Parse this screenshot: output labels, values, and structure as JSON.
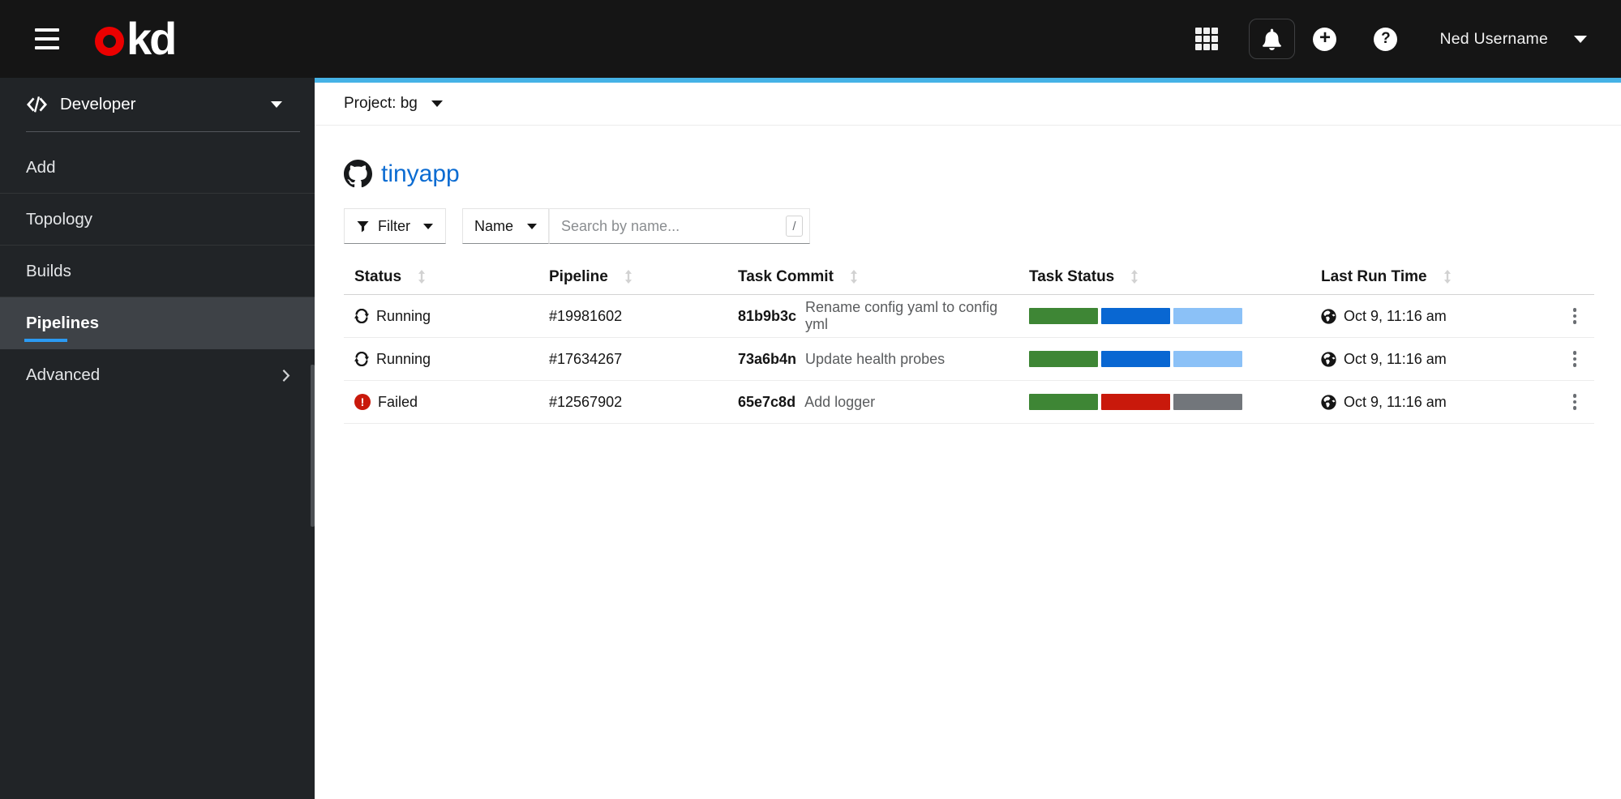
{
  "masthead": {
    "brand": {
      "text": "okd",
      "kd": "kd"
    },
    "user": {
      "name": "Ned Username"
    }
  },
  "sidebar": {
    "perspective": {
      "label": "Developer"
    },
    "items": [
      {
        "label": "Add"
      },
      {
        "label": "Topology"
      },
      {
        "label": "Builds"
      },
      {
        "label": "Pipelines",
        "active": true
      },
      {
        "label": "Advanced",
        "expandable": true
      }
    ]
  },
  "content": {
    "project_bar": {
      "label": "Project: bg"
    },
    "page_title": "tinyapp",
    "toolbar": {
      "filter_label": "Filter",
      "attribute_label": "Name",
      "search_placeholder": "Search by name...",
      "shortcut_key": "/"
    },
    "table": {
      "columns": [
        "Status",
        "Pipeline",
        "Task Commit",
        "Task Status",
        "Last Run Time"
      ],
      "rows": [
        {
          "status": "Running",
          "status_type": "running",
          "pipeline": "#19981602",
          "commit_hash": "81b9b3c",
          "commit_msg": "Rename config yaml to config yml",
          "segments": [
            "#3e8635",
            "#0967d2",
            "#8bc1f7"
          ],
          "time": "Oct 9, 11:16 am"
        },
        {
          "status": "Running",
          "status_type": "running",
          "pipeline": "#17634267",
          "commit_hash": "73a6b4n",
          "commit_msg": "Update health probes",
          "segments": [
            "#3e8635",
            "#0967d2",
            "#8bc1f7"
          ],
          "time": "Oct 9, 11:16 am"
        },
        {
          "status": "Failed",
          "status_type": "failed",
          "pipeline": "#12567902",
          "commit_hash": "65e7c8d",
          "commit_msg": "Add logger",
          "segments": [
            "#3e8635",
            "#c9190b",
            "#72767b"
          ],
          "time": "Oct 9, 11:16 am"
        }
      ]
    }
  },
  "colors": {
    "masthead_bg": "#151515",
    "sidebar_bg": "#212427",
    "sidebar_active_bg": "#3e4247",
    "active_underline": "#2b9af3",
    "content_accent_line": "#45b2e6",
    "link": "#0c6cd2",
    "success_green": "#3e8635",
    "running_blue": "#0967d2",
    "pending_blue": "#8bc1f7",
    "failed_red": "#c9190b",
    "skipped_gray": "#72767b"
  },
  "icons": {
    "menu": "hamburger-3-bars",
    "app_launcher": "3x3-grid",
    "notifications": "bell",
    "create": "plus-circle",
    "help": "question-circle",
    "user_caret": "caret-down",
    "perspective": "code-brackets",
    "repo": "github-octocat",
    "filter": "funnel",
    "sort": "arrows-up-down",
    "running": "sync-arrows",
    "failed": "exclamation-circle",
    "timestamp": "globe",
    "row_actions": "kebab-dots"
  }
}
